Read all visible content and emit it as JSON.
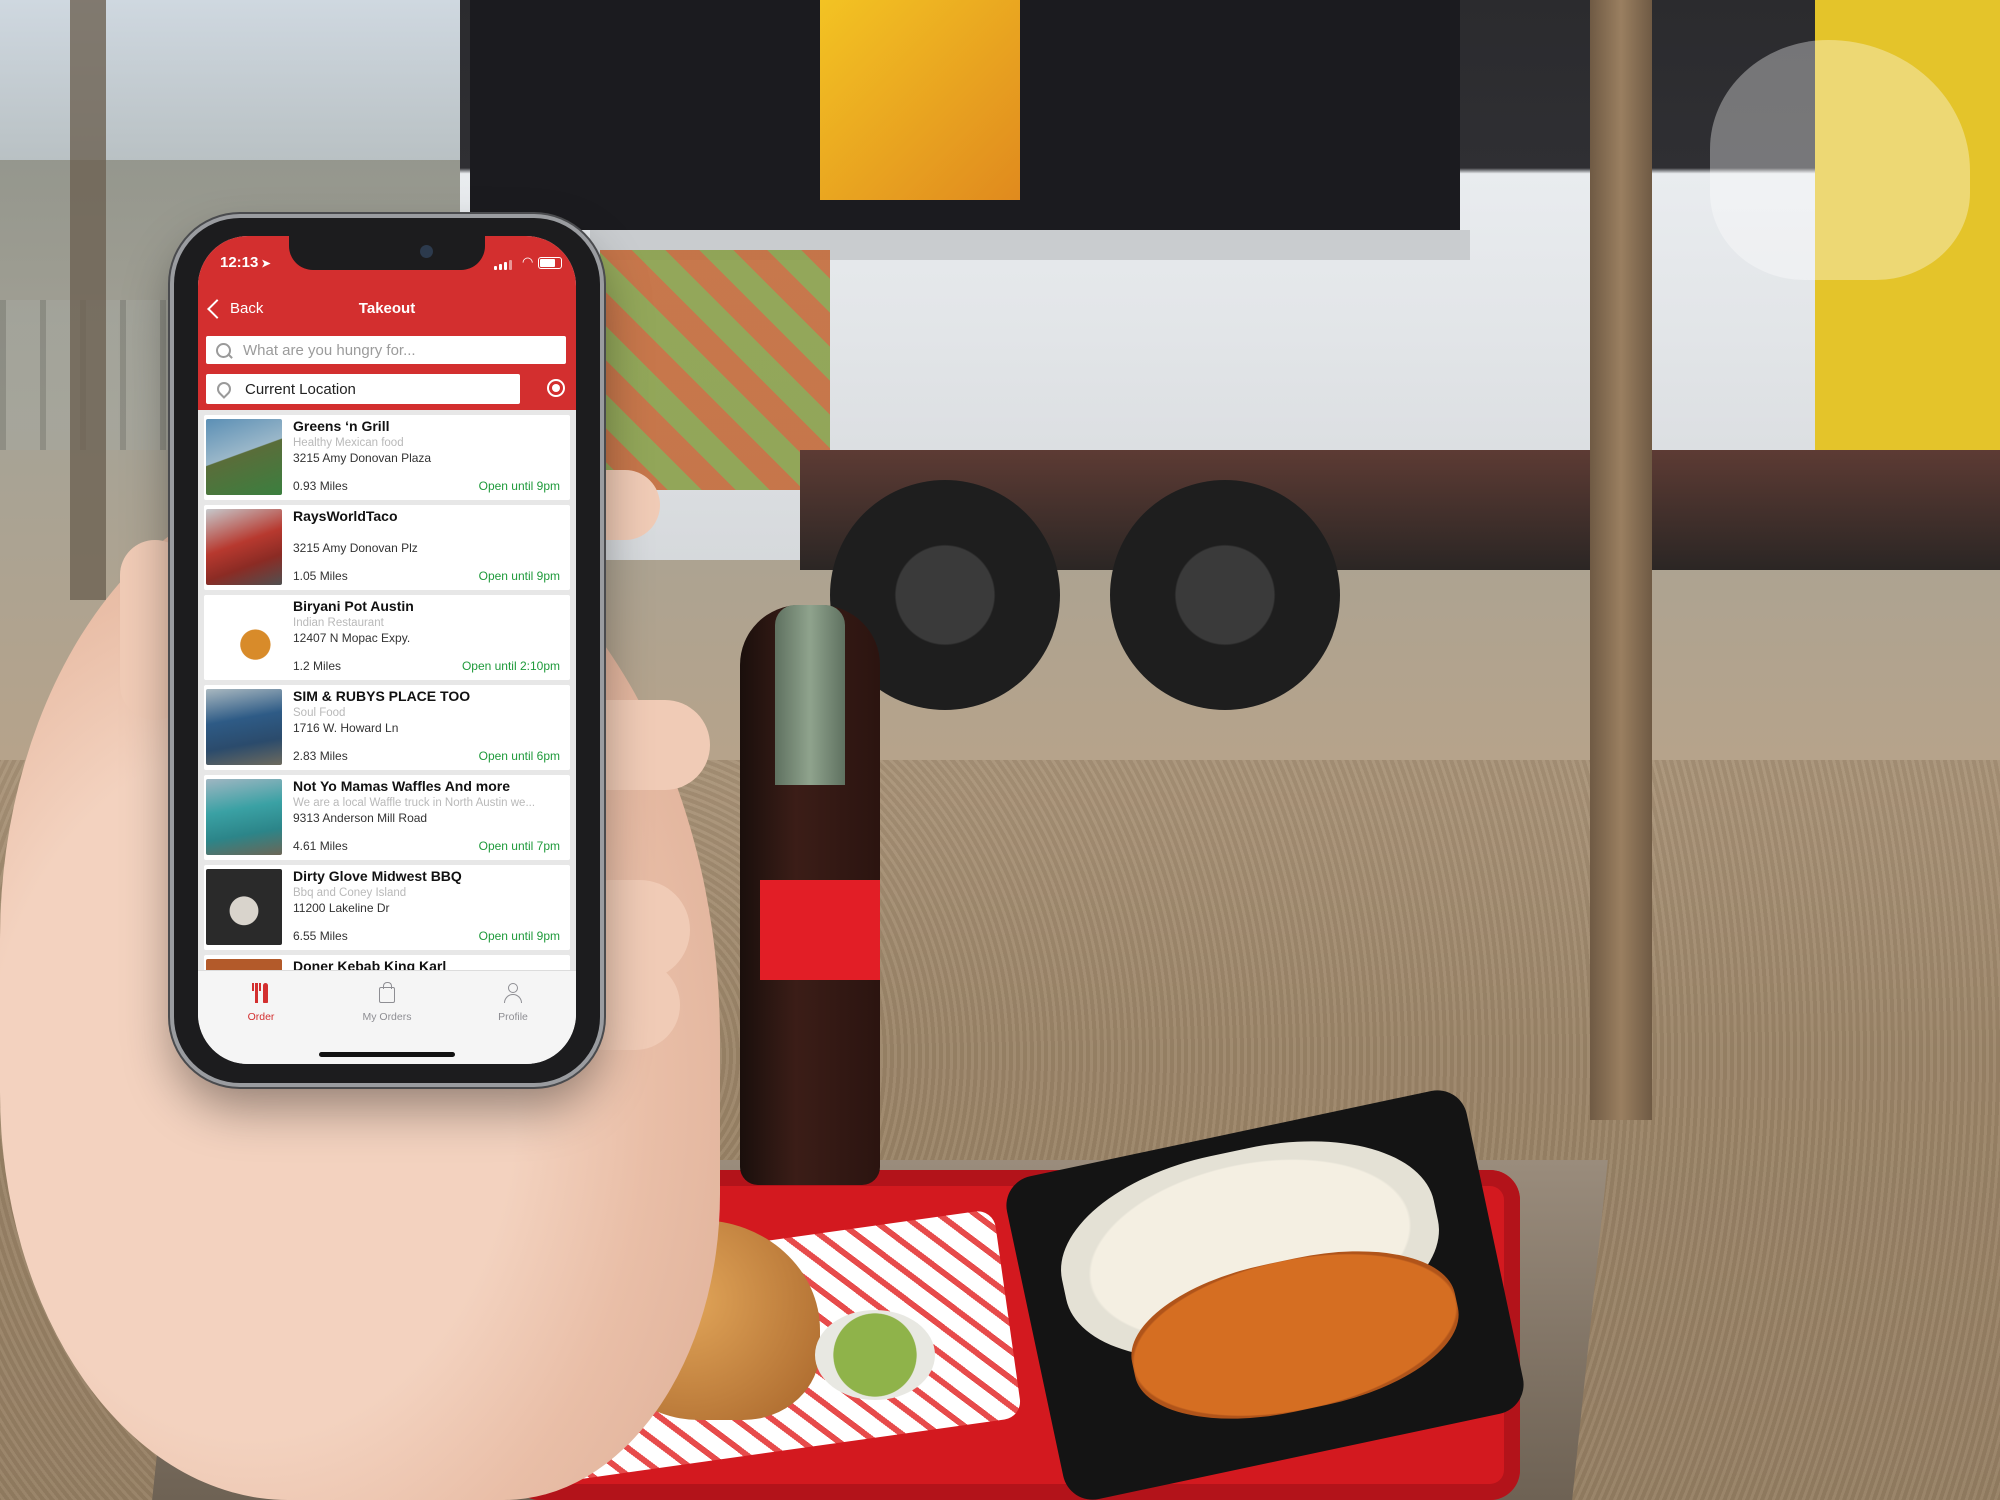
{
  "status_bar": {
    "time": "12:13"
  },
  "nav": {
    "back_label": "Back",
    "title": "Takeout"
  },
  "search": {
    "placeholder": "What are you hungry for..."
  },
  "location": {
    "label": "Current Location"
  },
  "restaurants": [
    {
      "name": "Greens ‘n Grill",
      "description": "Healthy Mexican food",
      "address": "3215 Amy  Donovan Plaza",
      "distance": "0.93 Miles",
      "hours": "Open until 9pm"
    },
    {
      "name": "RaysWorldTaco",
      "description": "",
      "address": "3215 Amy Donovan Plz",
      "distance": "1.05 Miles",
      "hours": "Open until 9pm"
    },
    {
      "name": "Biryani Pot Austin",
      "description": "Indian Restaurant",
      "address": "12407 N Mopac Expy.",
      "distance": "1.2 Miles",
      "hours": "Open until 2:10pm"
    },
    {
      "name": "SIM & RUBYS PLACE TOO",
      "description": "Soul Food",
      "address": "1716 W. Howard Ln",
      "distance": "2.83 Miles",
      "hours": "Open until 6pm"
    },
    {
      "name": "Not Yo Mamas Waffles And more",
      "description": "We are a local Waffle truck in North Austin we...",
      "address": "9313  Anderson Mill Road",
      "distance": "4.61 Miles",
      "hours": "Open until 7pm"
    },
    {
      "name": "Dirty Glove Midwest BBQ",
      "description": "Bbq and Coney Island",
      "address": "11200 Lakeline Dr",
      "distance": "6.55 Miles",
      "hours": "Open until 9pm"
    },
    {
      "name": "Doner Kebab King Karl",
      "description": "",
      "address": "",
      "distance": "",
      "hours": ""
    }
  ],
  "tabs": [
    {
      "label": "Order",
      "icon": "fork-knife-icon",
      "active": true
    },
    {
      "label": "My Orders",
      "icon": "shopping-bag-icon",
      "active": false
    },
    {
      "label": "Profile",
      "icon": "person-icon",
      "active": false
    }
  ],
  "colors": {
    "brand_red": "#d32f2f",
    "open_green": "#1f9a3b"
  }
}
